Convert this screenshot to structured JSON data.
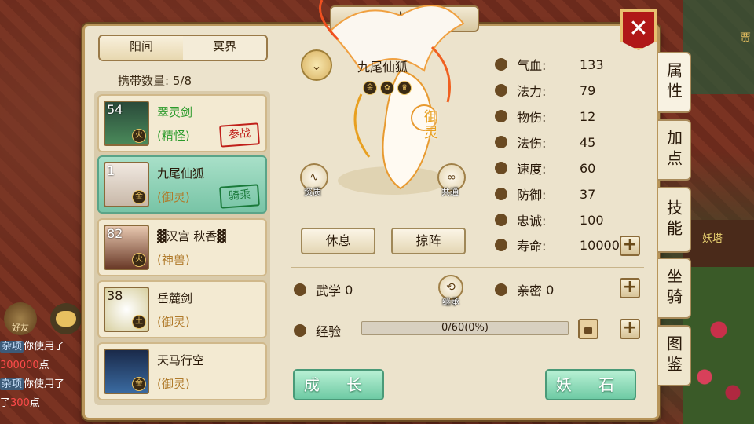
{
  "window": {
    "title": "性"
  },
  "background": {
    "right_text": "贾",
    "pagoda_label": "妖塔"
  },
  "chat": {
    "friend_label": "好友",
    "lines": [
      {
        "tag": "杂项",
        "text": "你使用了"
      },
      {
        "tag": "",
        "red": "300000",
        "text": "点"
      },
      {
        "tag": "杂项",
        "text": "你使用了"
      },
      {
        "tag": "",
        "prefix": "了",
        "red": "300",
        "text": "点"
      }
    ]
  },
  "tabs": [
    {
      "label": "阳间"
    },
    {
      "label": "冥界"
    }
  ],
  "carry": {
    "label": "携带数量:",
    "value": "5/8"
  },
  "pets": [
    {
      "level": "54",
      "name": "翠灵剑",
      "type": "(精怪)",
      "element": "火",
      "stamp": "参战"
    },
    {
      "level": "1",
      "name": "九尾仙狐",
      "type": "(御灵)",
      "element": "金",
      "stamp": "骑乘"
    },
    {
      "level": "82",
      "name": "▓汉宫 秋香▓",
      "type": "(神兽)",
      "element": "火",
      "stamp": ""
    },
    {
      "level": "38",
      "name": "岳麓剑",
      "type": "(御灵)",
      "element": "土",
      "stamp": ""
    },
    {
      "level": "",
      "name": "天马行空",
      "type": "(御灵)",
      "element": "金",
      "stamp": ""
    }
  ],
  "detail": {
    "name": "九尾仙狐",
    "badges": [
      "金",
      "✿",
      "♛"
    ],
    "class_label": "御灵",
    "aptitude_label": "资质",
    "shared_label": "共通",
    "inherit_label": "继承",
    "rest_button": "休息",
    "formation_button": "掠阵"
  },
  "stats": [
    {
      "label": "气血:",
      "value": "133",
      "icon": "heart-icon"
    },
    {
      "label": "法力:",
      "value": "79",
      "icon": "drop-icon"
    },
    {
      "label": "物伤:",
      "value": "12",
      "icon": "sword-icon"
    },
    {
      "label": "法伤:",
      "value": "45",
      "icon": "flame-icon"
    },
    {
      "label": "速度:",
      "value": "60",
      "icon": "lightning-icon"
    },
    {
      "label": "防御:",
      "value": "37",
      "icon": "shield-icon"
    },
    {
      "label": "忠诚:",
      "value": "100",
      "icon": "loyalty-icon"
    },
    {
      "label": "寿命:",
      "value": "10000",
      "icon": "lifespan-icon"
    }
  ],
  "skills": {
    "martial_label": "武学",
    "martial_value": "0",
    "intimacy_label": "亲密",
    "intimacy_value": "0"
  },
  "experience": {
    "label": "经验",
    "text": "0/60(0%)",
    "progress": 0
  },
  "buttons": {
    "grow": "成 长",
    "stone": "妖 石"
  },
  "right_tabs": [
    {
      "label": "属性",
      "active": true
    },
    {
      "label": "加点",
      "active": false
    },
    {
      "label": "技能",
      "active": false
    },
    {
      "label": "坐骑",
      "active": false
    },
    {
      "label": "图鉴",
      "active": false
    }
  ],
  "colors": {
    "accent_green": "#6ecaa4",
    "close_red": "#b01818",
    "gold": "#e8c060"
  }
}
